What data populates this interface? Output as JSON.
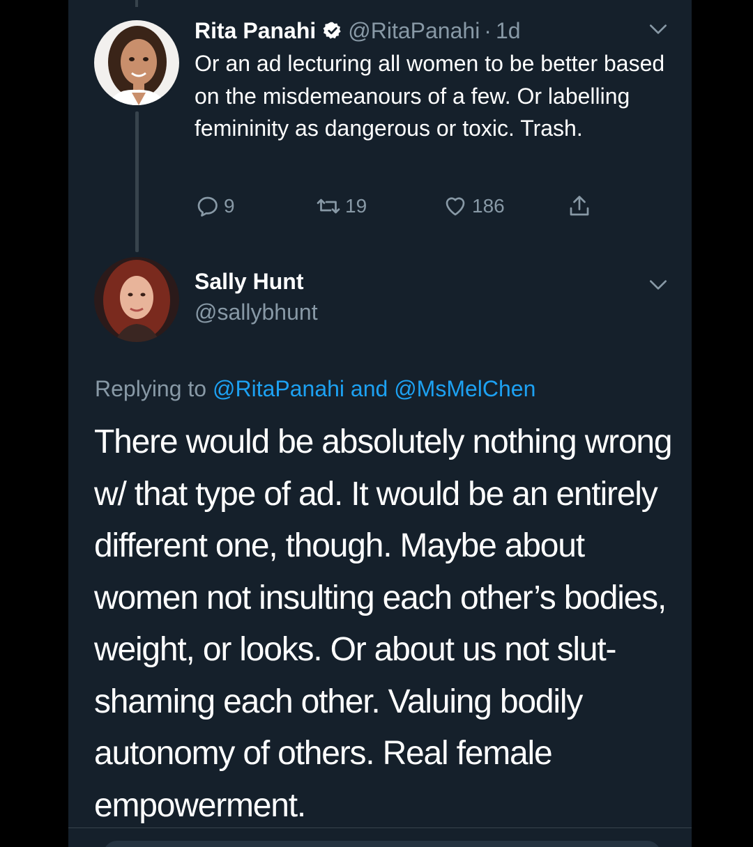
{
  "tweet1": {
    "name": "Rita Panahi",
    "handle": "@RitaPanahi",
    "separator": "·",
    "time": "1d",
    "text": "Or an ad lecturing all women to be better based on the misdemeanours of a few. Or labelling femininity as dangerous or toxic. Trash.",
    "counts": {
      "replies": "9",
      "retweets": "19",
      "likes": "186"
    }
  },
  "tweet2": {
    "name": "Sally Hunt",
    "handle": "@sallybhunt",
    "replying_prefix": "Replying to",
    "replying_user1": "@RitaPanahi",
    "replying_and": "and",
    "replying_user2": "@MsMelChen",
    "text": "There would be absolutely nothing wrong w/ that type of ad. It would be an entirely different one, though. Maybe about women not insulting each other’s bodies, weight, or looks. Or about us not slut-shaming each other. Valuing bodily autonomy of others. Real female empowerment."
  },
  "icons": [
    "verified-badge-icon",
    "chevron-down-icon",
    "reply-icon",
    "retweet-icon",
    "like-icon",
    "share-icon"
  ],
  "colors": {
    "background": "#15202b",
    "text": "#ffffff",
    "muted": "#8899a6",
    "link": "#1da1f2",
    "border": "#38444d"
  }
}
